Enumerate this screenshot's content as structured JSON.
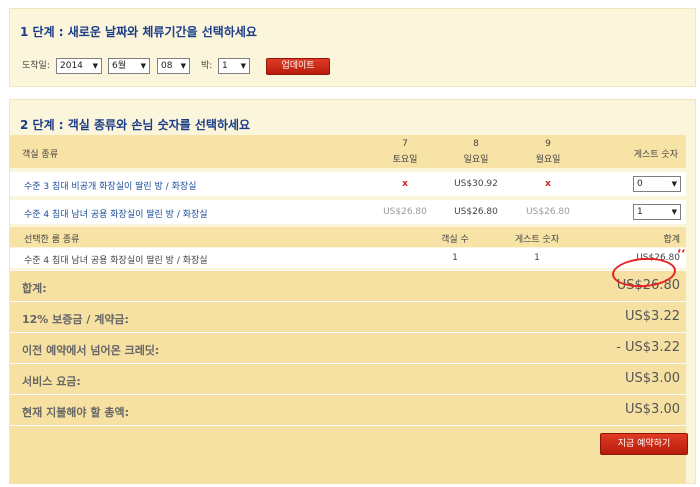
{
  "step1": {
    "title": "1 단계 : 새로운 날짜와 체류기간을 선택하세요",
    "arrival_label": "도착일:",
    "year": "2014",
    "month": "6월",
    "day": "08",
    "nights_label": "박:",
    "nights": "1",
    "update_label": "업데이트"
  },
  "step2": {
    "title": "2 단계 : 객실 종류와 손님 숫자를 선택하세요",
    "header": {
      "room_type": "객실 종류",
      "days": [
        {
          "num": "7",
          "name": "토요일"
        },
        {
          "num": "8",
          "name": "일요일"
        },
        {
          "num": "9",
          "name": "월요일"
        }
      ],
      "guests": "게스트 숫자"
    },
    "rooms": [
      {
        "name": "수준 3 침대 비공개 화장실이 딸린 방 / 화장실",
        "prices": [
          "x",
          "US$30.92",
          "x"
        ],
        "guests": "0"
      },
      {
        "name": "수준 4 침대 남녀 공용 화장실이 딸린 방 / 화장실",
        "prices": [
          "US$26.80",
          "US$26.80",
          "US$26.80"
        ],
        "guests": "1"
      }
    ],
    "selected_header": {
      "room_type": "선택한 룸 종류",
      "room_count": "객실 수",
      "guests": "게스트 숫자",
      "total": "합계"
    },
    "selected": {
      "name": "수준 4 침대 남녀 공용 화장실이 딸린 방 / 화장실",
      "room_count": "1",
      "guests": "1",
      "total": "US$26.80"
    },
    "summary": [
      {
        "label": "합계:",
        "amount": "US$26.80"
      },
      {
        "label": "12% 보증금 / 계약금:",
        "amount": "US$3.22"
      },
      {
        "label": "이전 예약에서 넘어온 크레딧:",
        "amount": "- US$3.22"
      },
      {
        "label": "서비스 요금:",
        "amount": "US$3.00"
      },
      {
        "label": "현재 지불해야 할 총액:",
        "amount": "US$3.00"
      }
    ],
    "book_label": "지금 예약하기"
  },
  "annotation_mark": "ʻʻ",
  "colors": {
    "accent_red": "#c8240f",
    "title_blue": "#1a3d86",
    "header_bg": "#f8e3a6",
    "panel_bg": "#fbf5dc"
  }
}
